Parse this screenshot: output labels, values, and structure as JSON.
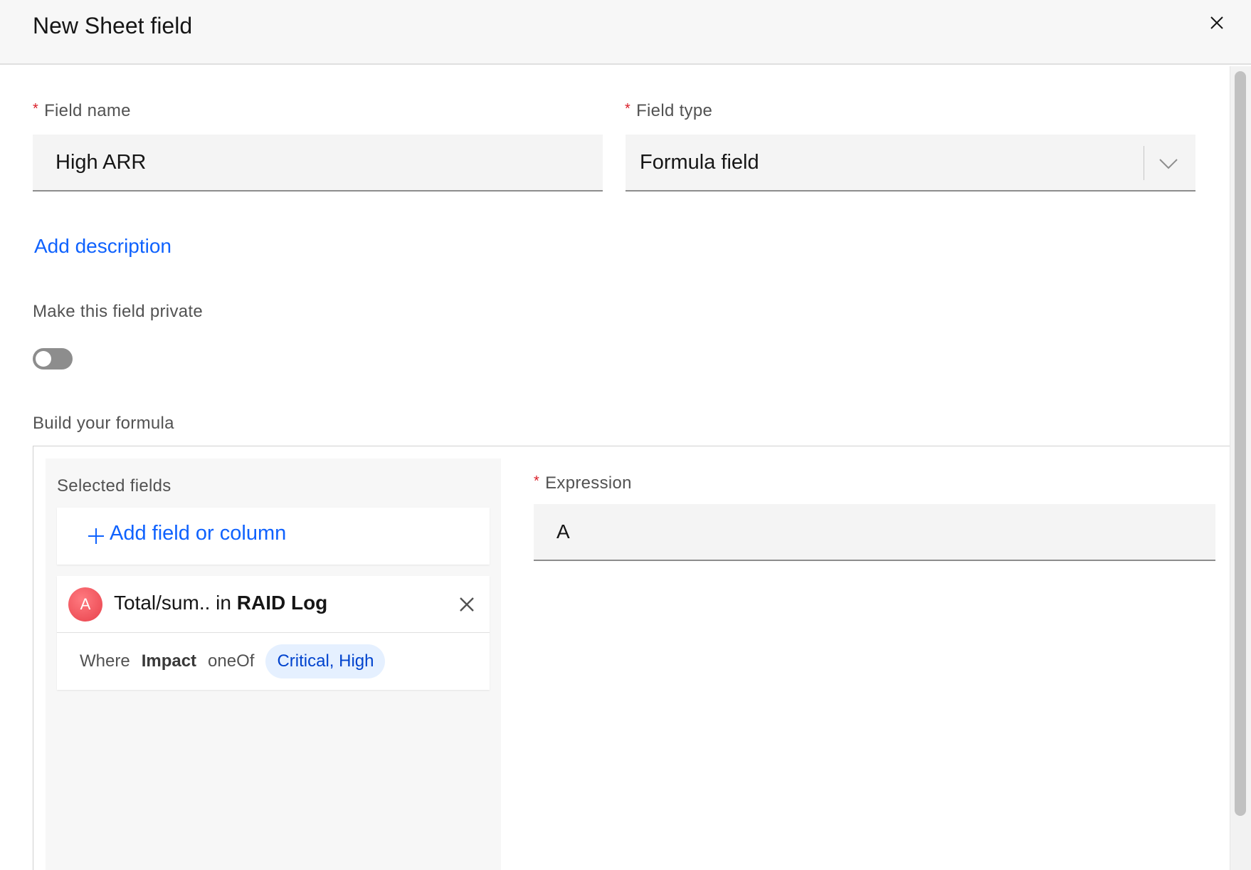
{
  "dialog": {
    "title": "New Sheet field"
  },
  "form": {
    "field_name": {
      "required_mark": "*",
      "label": "Field name",
      "value": "High ARR"
    },
    "field_type": {
      "required_mark": "*",
      "label": "Field type",
      "value": "Formula field"
    },
    "add_description_link": "Add description",
    "private_toggle": {
      "label": "Make this field private",
      "checked": false
    }
  },
  "formula": {
    "section_label": "Build your formula",
    "selected_fields": {
      "label": "Selected fields",
      "add_button_label": "Add field or column",
      "items": [
        {
          "letter": "A",
          "name": "Total/sum..",
          "connector": "in",
          "source": "RAID Log",
          "condition": {
            "prefix": "Where",
            "field": "Impact",
            "operator": "oneOf",
            "values": "Critical, High"
          }
        }
      ]
    },
    "expression": {
      "required_mark": "*",
      "label": "Expression",
      "value": "A"
    }
  },
  "colors": {
    "link": "#0f62fe",
    "required": "#da1e28",
    "avatar": "#e8414b",
    "tag_bg": "#e5f0ff",
    "tag_text": "#0043ce"
  },
  "icons": {
    "close": "close-icon",
    "dropdown": "chevron-down-icon",
    "add": "plus-icon",
    "remove": "close-icon"
  }
}
